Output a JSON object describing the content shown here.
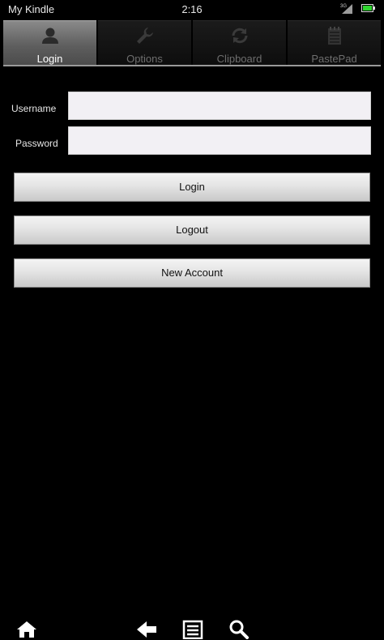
{
  "status_bar": {
    "device_name": "My Kindle",
    "time": "2:16",
    "signal_label": "3G"
  },
  "tabs": [
    {
      "label": "Login",
      "icon": "person-icon",
      "active": true
    },
    {
      "label": "Options",
      "icon": "wrench-icon",
      "active": false
    },
    {
      "label": "Clipboard",
      "icon": "sync-icon",
      "active": false
    },
    {
      "label": "PastePad",
      "icon": "notepad-icon",
      "active": false
    }
  ],
  "form": {
    "username_label": "Username",
    "username_value": "",
    "password_label": "Password",
    "password_value": ""
  },
  "buttons": {
    "login": "Login",
    "logout": "Logout",
    "new_account": "New Account"
  },
  "bottom_nav": [
    "home-icon",
    "back-icon",
    "menu-icon",
    "search-icon"
  ],
  "colors": {
    "background": "#000000",
    "battery": "#2fd42f",
    "active_tab": "#6a6a6a",
    "input_bg": "#f2f0f4"
  }
}
